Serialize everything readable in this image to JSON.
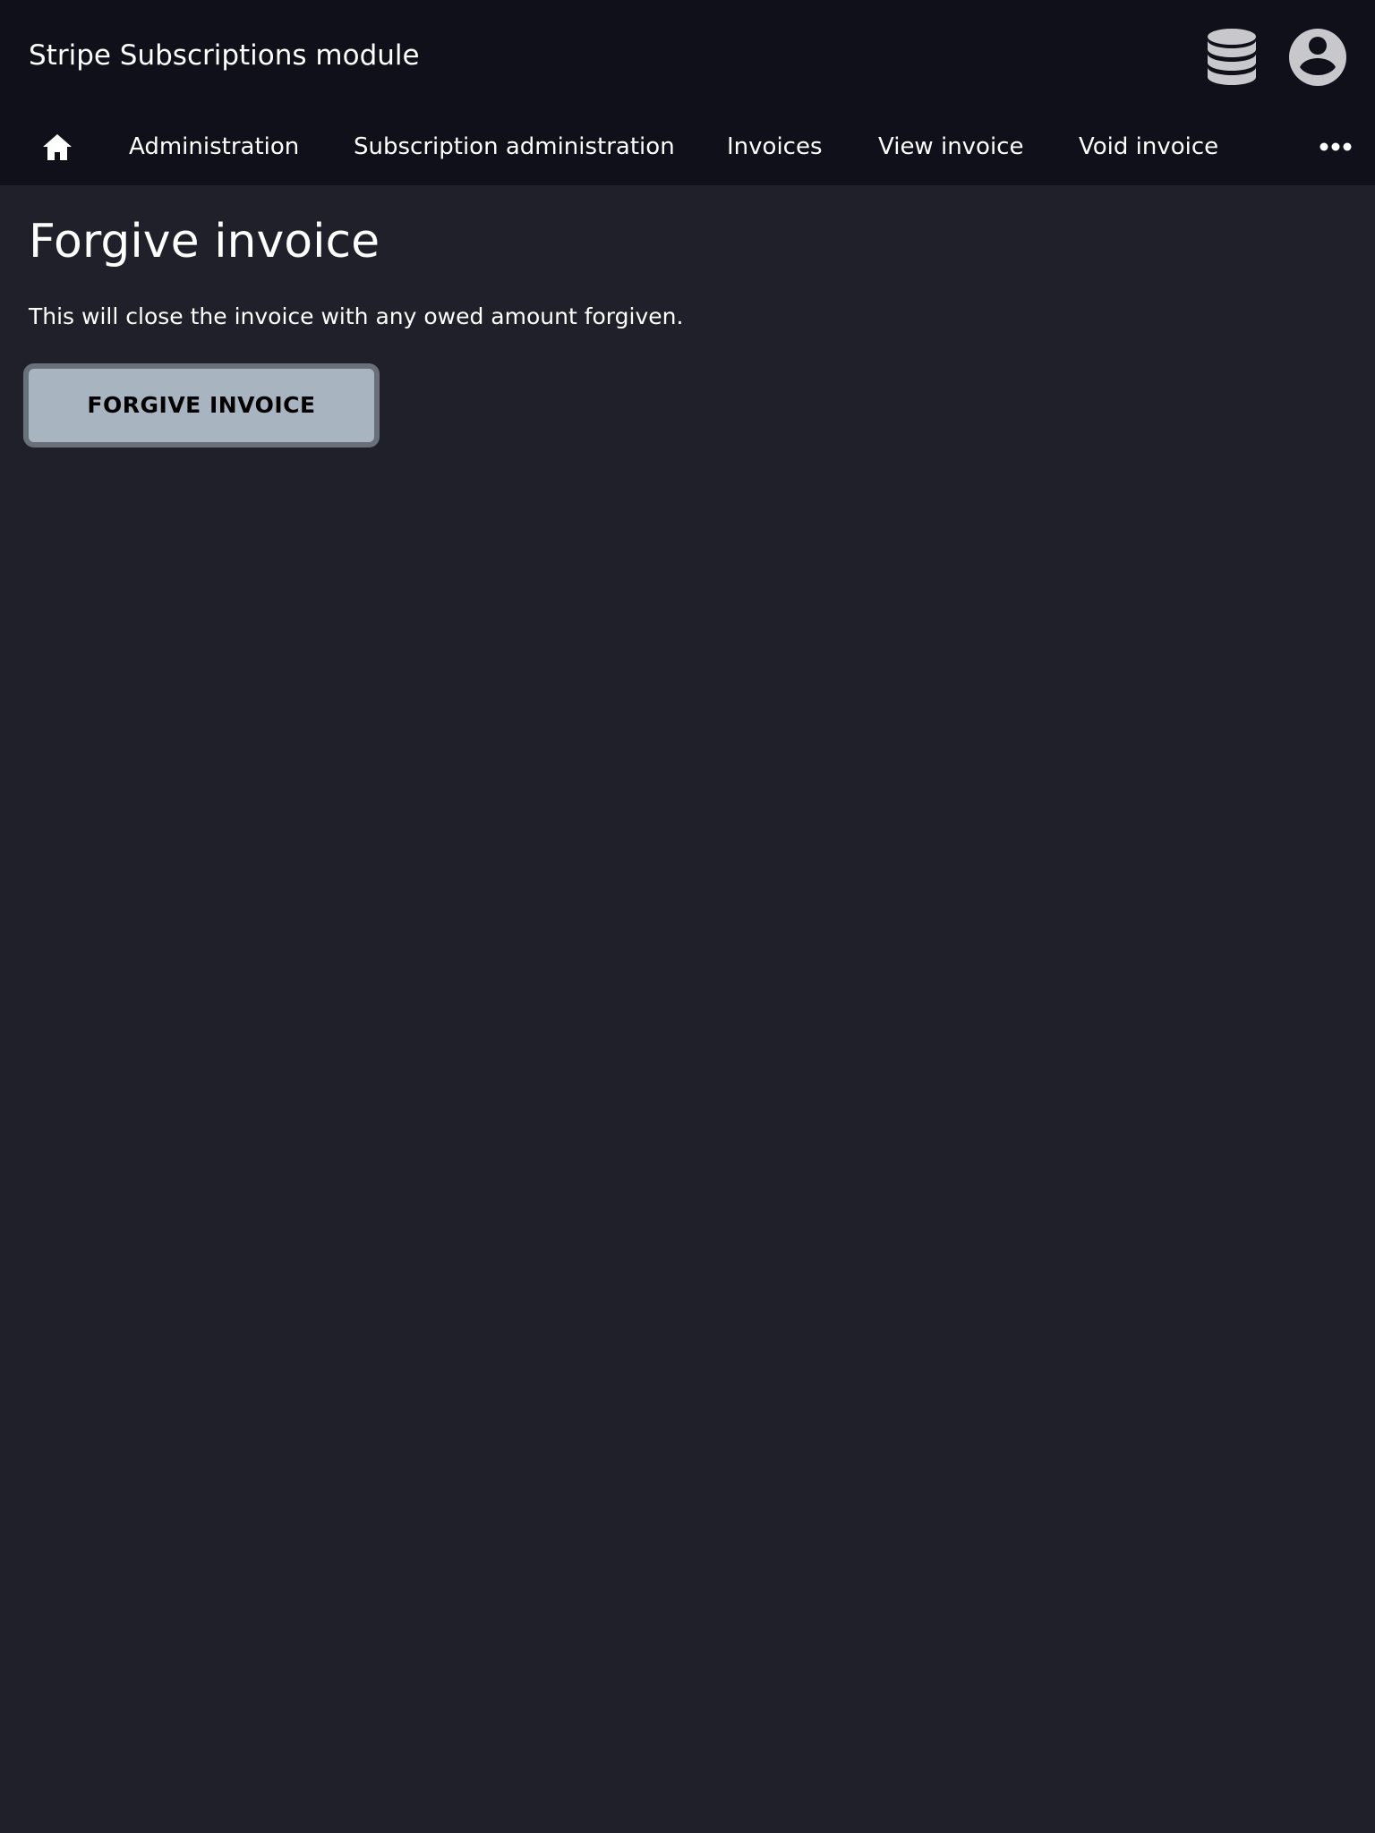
{
  "header": {
    "app_title": "Stripe Subscriptions module",
    "icons": {
      "database": "database-icon",
      "user": "user-circle-icon"
    }
  },
  "nav": {
    "home_icon": "home-icon",
    "items": [
      {
        "label": "Administration"
      },
      {
        "label": "Subscription administration"
      },
      {
        "label": "Invoices"
      },
      {
        "label": "View invoice"
      },
      {
        "label": "Void invoice"
      }
    ],
    "more_icon": "ellipsis-icon"
  },
  "main": {
    "title": "Forgive invoice",
    "description": "This will close the invoice with any owed amount forgiven.",
    "button_label": "FORGIVE INVOICE"
  },
  "colors": {
    "page_background": "#20202a",
    "bar_background": "#10101a",
    "button_fill": "#a8b4bf",
    "button_border": "#6a7079",
    "icon_gray": "#c8c8cc"
  }
}
